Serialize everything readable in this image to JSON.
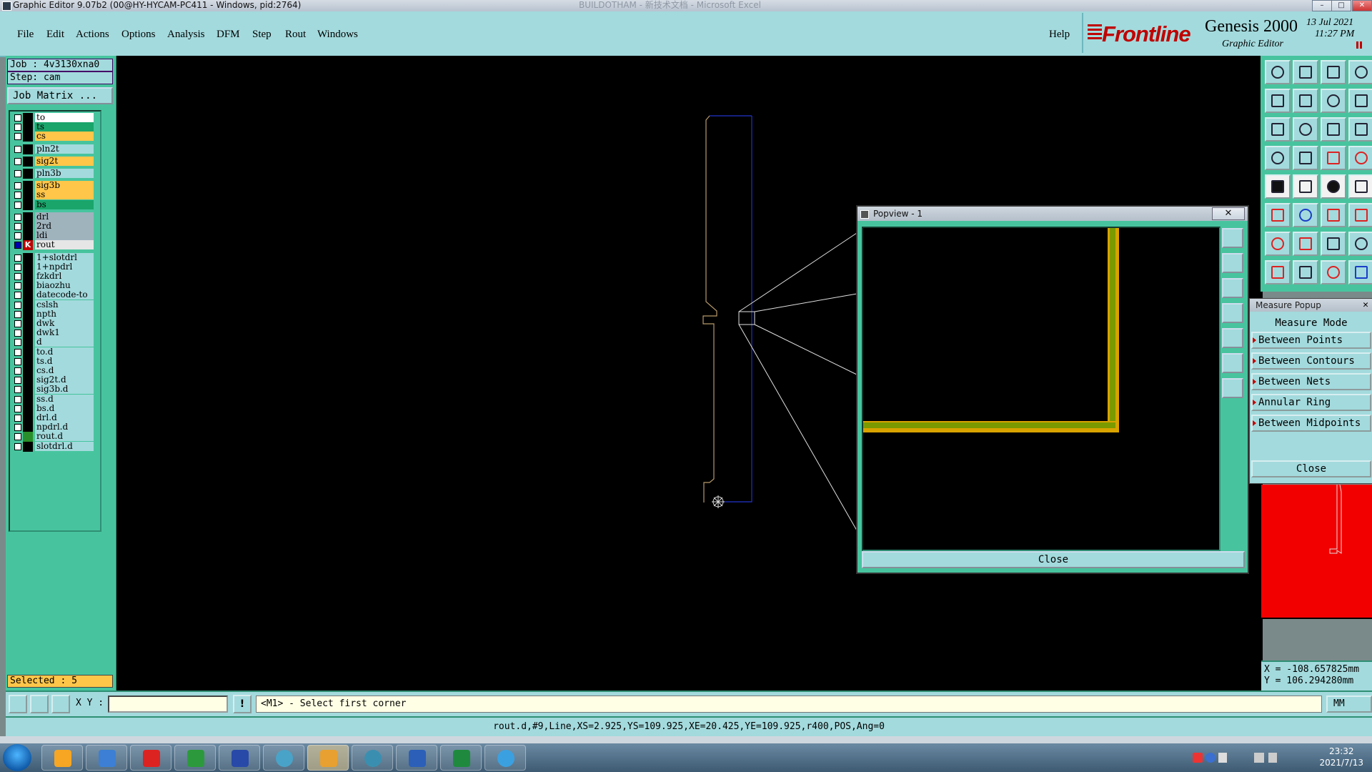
{
  "window": {
    "title": "Graphic Editor 9.07b2 (00@HY-HYCAM-PC411 - Windows, pid:2764)",
    "background_title": "BUILDOTHAM - 新技术文档 - Microsoft Excel"
  },
  "menu": {
    "items": [
      "File",
      "Edit",
      "Actions",
      "Options",
      "Analysis",
      "DFM",
      "Step",
      "Rout",
      "Windows"
    ],
    "help": "Help"
  },
  "brand": {
    "logo": "Frontline",
    "product": "Genesis 2000",
    "subtitle": "Graphic Editor",
    "date": "13 Jul 2021",
    "time": "11:27 PM"
  },
  "job": {
    "job_label": "Job : 4v3130xna0",
    "step_label": "Step: cam",
    "matrix_button": "Job Matrix ...",
    "selected": "Selected : 5"
  },
  "layers": [
    {
      "name": "to",
      "color": "#ffffff",
      "checked": false,
      "marker": "none"
    },
    {
      "name": "ts",
      "color": "#1aa56b",
      "checked": false,
      "marker": "none"
    },
    {
      "name": "cs",
      "color": "#ffc64a",
      "checked": false,
      "marker": "none"
    },
    {
      "name": "pln2t",
      "color": "#a3dadd",
      "checked": false,
      "marker": "none",
      "gap": true
    },
    {
      "name": "sig2t",
      "color": "#ffc64a",
      "checked": false,
      "marker": "none",
      "gap": true
    },
    {
      "name": "pln3b",
      "color": "#a3dadd",
      "checked": false,
      "marker": "none",
      "gap": true
    },
    {
      "name": "sig3b",
      "color": "#ffc64a",
      "checked": false,
      "marker": "none",
      "gap": true
    },
    {
      "name": "ss",
      "color": "#ffc64a",
      "checked": false,
      "marker": "none"
    },
    {
      "name": "bs",
      "color": "#1aa56b",
      "checked": false,
      "marker": "none"
    },
    {
      "name": "drl",
      "color": "#9fb3bd",
      "checked": false,
      "marker": "none",
      "gap": true
    },
    {
      "name": "2rd",
      "color": "#9fb3bd",
      "checked": false,
      "marker": "none"
    },
    {
      "name": "ldi",
      "color": "#9fb3bd",
      "checked": false,
      "marker": "none"
    },
    {
      "name": "rout",
      "color": "#e6e6e6",
      "checked": true,
      "marker": "k"
    },
    {
      "name": "1+slotdrl",
      "color": "#a3dadd",
      "checked": false,
      "marker": "none",
      "gap": true
    },
    {
      "name": "1+npdrl",
      "color": "#a3dadd",
      "checked": false,
      "marker": "none"
    },
    {
      "name": "fzkdrl",
      "color": "#a3dadd",
      "checked": false,
      "marker": "none"
    },
    {
      "name": "biaozhu",
      "color": "#a3dadd",
      "checked": false,
      "marker": "none"
    },
    {
      "name": "datecode-to",
      "color": "#a3dadd",
      "checked": false,
      "marker": "none"
    },
    {
      "name": "cslsh",
      "color": "#a3dadd",
      "checked": false,
      "marker": "none"
    },
    {
      "name": "npth",
      "color": "#a3dadd",
      "checked": false,
      "marker": "none"
    },
    {
      "name": "dwk",
      "color": "#a3dadd",
      "checked": false,
      "marker": "none"
    },
    {
      "name": "dwk1",
      "color": "#a3dadd",
      "checked": false,
      "marker": "none"
    },
    {
      "name": "d",
      "color": "#a3dadd",
      "checked": false,
      "marker": "none"
    },
    {
      "name": "to.d",
      "color": "#a3dadd",
      "checked": false,
      "marker": "none"
    },
    {
      "name": "ts.d",
      "color": "#a3dadd",
      "checked": false,
      "marker": "none"
    },
    {
      "name": "cs.d",
      "color": "#a3dadd",
      "checked": false,
      "marker": "none"
    },
    {
      "name": "sig2t.d",
      "color": "#a3dadd",
      "checked": false,
      "marker": "none"
    },
    {
      "name": "sig3b.d",
      "color": "#a3dadd",
      "checked": false,
      "marker": "none"
    },
    {
      "name": "ss.d",
      "color": "#a3dadd",
      "checked": false,
      "marker": "none"
    },
    {
      "name": "bs.d",
      "color": "#a3dadd",
      "checked": false,
      "marker": "none"
    },
    {
      "name": "drl.d",
      "color": "#a3dadd",
      "checked": false,
      "marker": "none"
    },
    {
      "name": "npdrl.d",
      "color": "#a3dadd",
      "checked": false,
      "marker": "none"
    },
    {
      "name": "rout.d",
      "color": "#a3dadd",
      "checked": false,
      "marker": "g"
    },
    {
      "name": "slotdrl.d",
      "color": "#a3dadd",
      "checked": false,
      "marker": "none"
    }
  ],
  "popview": {
    "title": "Popview - 1",
    "close_label": "Close",
    "close_x": "✕"
  },
  "measure": {
    "title": "Measure Popup",
    "close_x": "✕",
    "mode_label": "Measure Mode",
    "options": [
      "Between Points",
      "Between Contours",
      "Between Nets",
      "Annular Ring",
      "Between Midpoints"
    ],
    "close_label": "Close"
  },
  "coords": {
    "x": "X = -108.657825mm",
    "y": "Y = 106.294280mm"
  },
  "command": {
    "xy_label": "X Y :",
    "xy_value": "",
    "bang": "!",
    "prompt": "<M1> - Select first corner",
    "units": "MM"
  },
  "status_line": "rout.d,#9,Line,XS=2.925,YS=109.925,XE=20.425,YE=109.925,r400,POS,Ang=0",
  "taskbar": {
    "clock_time": "23:32",
    "clock_date": "2021/7/13"
  }
}
